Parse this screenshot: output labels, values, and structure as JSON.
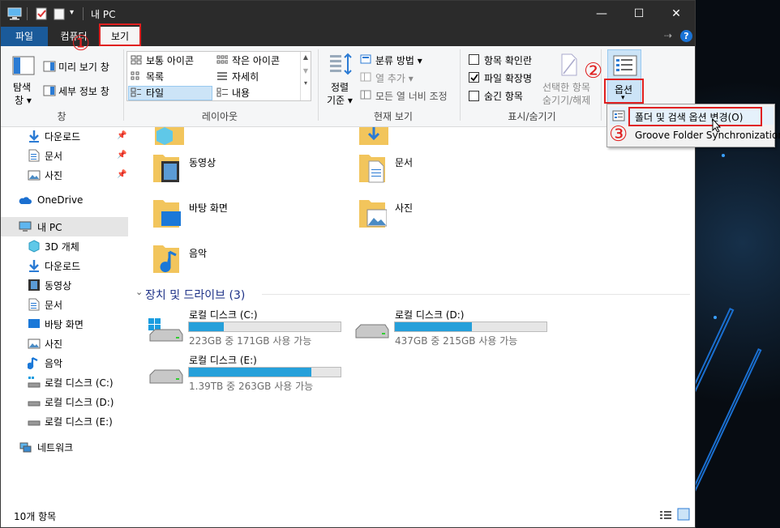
{
  "window": {
    "title": "내 PC"
  },
  "menu": {
    "file": "파일",
    "computer": "컴퓨터",
    "view": "보기"
  },
  "ribbon": {
    "pane": {
      "nav_pane_label": "탐색\n창",
      "nav_pane_line1": "탐색",
      "nav_pane_line2": "창 ▾",
      "preview": "미리 보기 창",
      "details": "세부 정보 창",
      "group": "창"
    },
    "layout": {
      "items": [
        "보통 아이콘",
        "작은 아이콘",
        "목록",
        "자세히",
        "타일",
        "내용"
      ],
      "group": "레이아웃"
    },
    "current_view": {
      "sort_line1": "정렬",
      "sort_line2": "기준 ▾",
      "group_by": "분류 방법 ▾",
      "add_columns": "열 추가 ▾",
      "fit_columns": "모든 열 너비 조정",
      "group": "현재 보기"
    },
    "show_hide": {
      "item_checkboxes": "항목 확인란",
      "file_extensions": "파일 확장명",
      "hidden_items": "숨긴 항목",
      "hide_selected_line1": "선택한 항목",
      "hide_selected_line2": "숨기기/해제",
      "group": "표시/숨기기"
    },
    "options": {
      "label": "옵션",
      "arrow": "▾"
    }
  },
  "dropdown": {
    "change_options": "폴더 및 검색 옵션 변경(O)",
    "groove": "Groove Folder Synchronization"
  },
  "annotations": {
    "one": "①",
    "two": "②",
    "three": "③"
  },
  "nav": {
    "quick": [
      {
        "label": "다운로드"
      },
      {
        "label": "문서"
      },
      {
        "label": "사진"
      }
    ],
    "onedrive": "OneDrive",
    "thispc": "내 PC",
    "pc_items": [
      "3D 개체",
      "다운로드",
      "동영상",
      "문서",
      "바탕 화면",
      "사진",
      "음악",
      "로컬 디스크 (C:)",
      "로컬 디스크 (D:)",
      "로컬 디스크 (E:)"
    ],
    "network": "네트워크"
  },
  "content": {
    "folders": [
      "동영상",
      "문서",
      "바탕 화면",
      "사진",
      "음악"
    ],
    "devices_header": "장치 및 드라이브 (3)",
    "drives": [
      {
        "name": "로컬 디스크 (C:)",
        "sub": "223GB 중 171GB 사용 가능",
        "used_fraction": 0.23
      },
      {
        "name": "로컬 디스크 (D:)",
        "sub": "437GB 중 215GB 사용 가능",
        "used_fraction": 0.51
      },
      {
        "name": "로컬 디스크 (E:)",
        "sub": "1.39TB 중 263GB 사용 가능",
        "used_fraction": 0.81
      }
    ]
  },
  "status": {
    "count": "10개 항목"
  },
  "colors": {
    "accent": "#26a0da",
    "annotation": "#e02020",
    "titlebar": "#2b2b2b"
  }
}
